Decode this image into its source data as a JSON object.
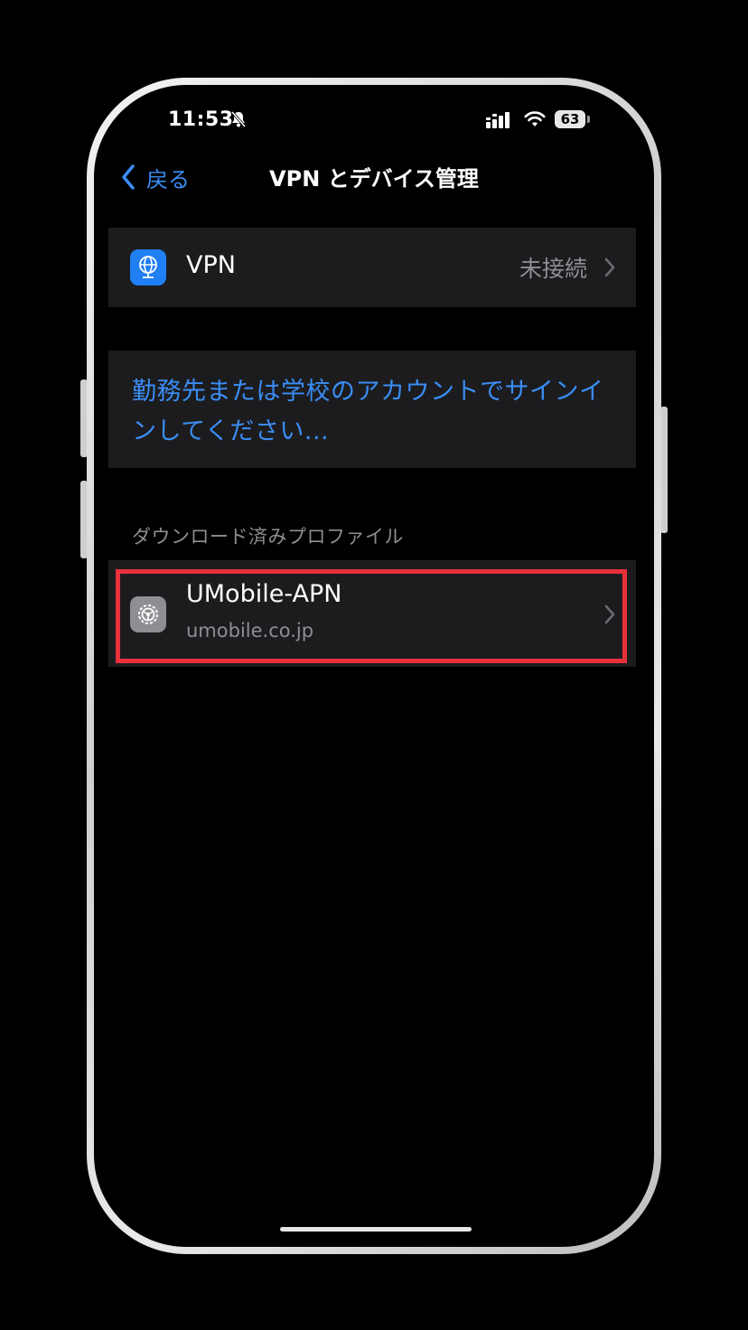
{
  "status_bar": {
    "time": "11:53",
    "battery": "63",
    "icons": [
      "bell-slash-icon",
      "signal-icon",
      "wifi-icon",
      "battery-icon"
    ]
  },
  "nav": {
    "back_label": "戻る",
    "title": "VPN とデバイス管理"
  },
  "vpn_row": {
    "label": "VPN",
    "status": "未接続",
    "icon": "vpn-globe-icon"
  },
  "signin": {
    "text": "勤務先または学校のアカウントでサインインしてください..."
  },
  "downloaded_profiles": {
    "header": "ダウンロード済みプロファイル",
    "items": [
      {
        "name": "UMobile-APN",
        "domain": "umobile.co.jp",
        "icon": "settings-gear-icon"
      }
    ]
  },
  "colors": {
    "accent": "#3a8df5",
    "highlight": "#e8313b",
    "cell_background": "#1c1c1e",
    "secondary_text": "#8e8e93"
  }
}
